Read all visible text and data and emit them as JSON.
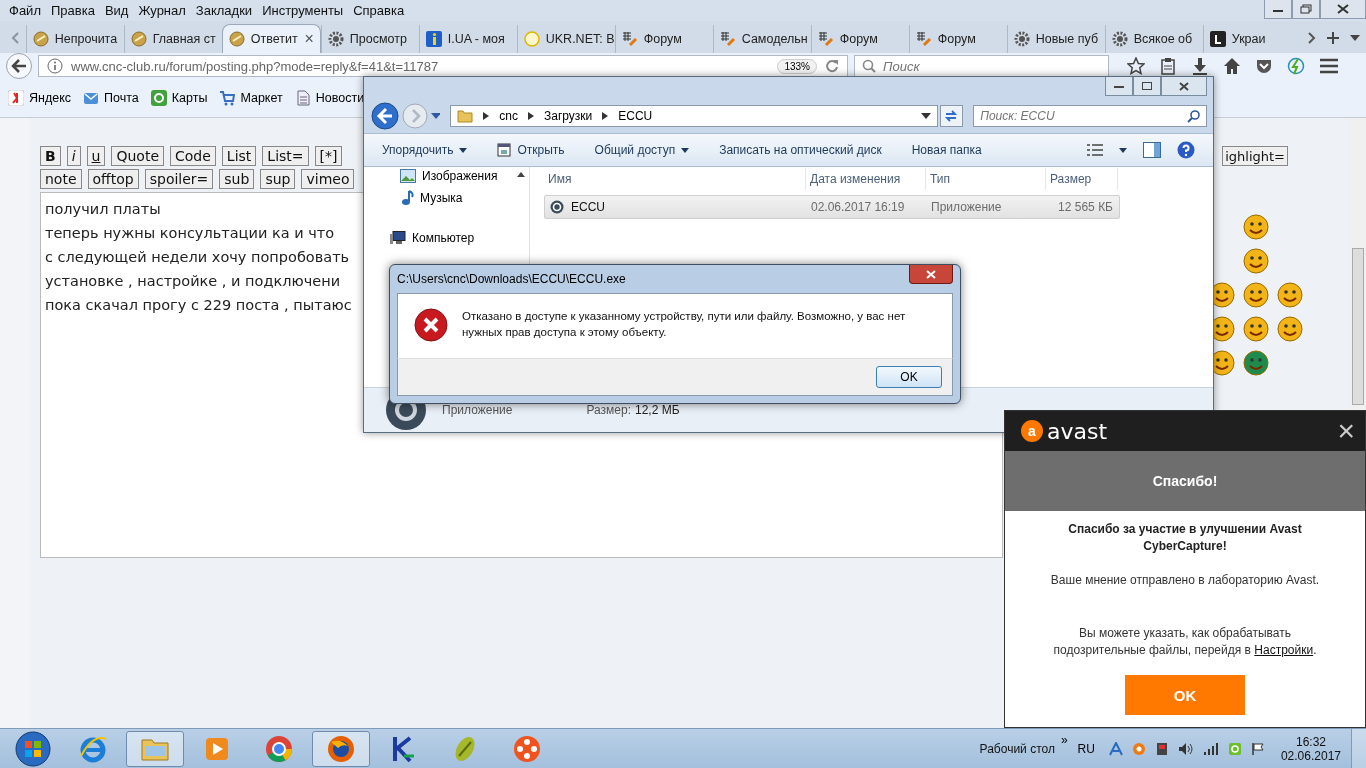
{
  "browser": {
    "menu": [
      "Файл",
      "Правка",
      "Вид",
      "Журнал",
      "Закладки",
      "Инструменты",
      "Справка"
    ],
    "tabs": [
      {
        "label": "Непрочита",
        "selected": false
      },
      {
        "label": "Главная ст",
        "selected": false
      },
      {
        "label": "Ответит",
        "selected": true
      },
      {
        "label": "Просмотр",
        "selected": false
      },
      {
        "label": "I.UA - моя",
        "selected": false
      },
      {
        "label": "UKR.NET: В",
        "selected": false
      },
      {
        "label": "Форум",
        "selected": false
      },
      {
        "label": "Самодельн",
        "selected": false
      },
      {
        "label": "Форум",
        "selected": false
      },
      {
        "label": "Форум",
        "selected": false
      },
      {
        "label": "Новые пуб",
        "selected": false
      },
      {
        "label": "Всякое об",
        "selected": false
      },
      {
        "label": "Украи",
        "selected": false
      }
    ],
    "close_tab": "×",
    "address": {
      "url": "www.cnc-club.ru/forum/posting.php?mode=reply&f=41&t=11787",
      "zoom": "133%"
    },
    "search": {
      "placeholder": "Поиск"
    },
    "bookmarks": [
      "Яндекс",
      "Почта",
      "Карты",
      "Маркет",
      "Новости"
    ]
  },
  "editor": {
    "toolbar_rows": [
      [
        "B",
        "i",
        "u",
        "Quote",
        "Code",
        "List",
        "List=",
        "[*]"
      ],
      [
        "note",
        "offtop",
        "spoiler=",
        "sub",
        "sup",
        "vimeo"
      ]
    ],
    "right_button": "ighlight=",
    "text_lines": [
      "получил платы",
      "теперь нужны консультации ка и что",
      "с следующей недели хочу попробовать",
      "установке , настройке , и подключени",
      "пока скачал прогу с 229 поста , пытаюс"
    ]
  },
  "explorer": {
    "breadcrumb": [
      "cnc",
      "Загрузки",
      "ECCU"
    ],
    "search": {
      "placeholder": "Поиск: ECCU"
    },
    "toolbar": [
      {
        "label": "Упорядочить",
        "dropdown": true
      },
      {
        "label": "Открыть",
        "dropdown": false
      },
      {
        "label": "Общий доступ",
        "dropdown": true
      },
      {
        "label": "Записать на оптический диск",
        "dropdown": false
      },
      {
        "label": "Новая папка",
        "dropdown": false
      }
    ],
    "nav": [
      "Изображения",
      "Музыка",
      "Компьютер"
    ],
    "columns": [
      "Имя",
      "Дата изменения",
      "Тип",
      "Размер"
    ],
    "rows": [
      {
        "name": "ECCU",
        "date": "02.06.2017 16:19",
        "type": "Приложение",
        "size": "12 565 КБ",
        "selected": true
      }
    ],
    "details": {
      "type": "Приложение",
      "size_label": "Размер:",
      "size": "12,2 МБ"
    }
  },
  "dialog": {
    "title": "C:\\Users\\cnc\\Downloads\\ECCU\\ECCU.exe",
    "message": "Отказано в доступе к указанному устройству, пути или файлу. Возможно,  у вас нет нужных прав доступа к этому объекту.",
    "button": "OK"
  },
  "avast": {
    "brand": "avast",
    "logo_letter": "a",
    "close": "×",
    "heading": "Спасибо!",
    "title": "Спасибо за участие в улучшении Avast CyberCapture!",
    "note": "Ваше мнение отправлено в лабораторию Avast.",
    "hint": "Вы можете указать, как обрабатывать подозрительные файлы, перейдя в",
    "link": "Настройки",
    "hint_end": ".",
    "button": "OK"
  },
  "taskbar": {
    "apps": [
      {
        "kind": "ie",
        "active": false
      },
      {
        "kind": "folder",
        "active": true
      },
      {
        "kind": "media",
        "active": false
      },
      {
        "kind": "chrome",
        "active": false
      },
      {
        "kind": "firefox",
        "active": true
      },
      {
        "kind": "k",
        "active": false
      },
      {
        "kind": "s",
        "active": false
      },
      {
        "kind": "reel",
        "active": false
      }
    ],
    "desktop_label": "Рабочий стол",
    "expand": "»",
    "language": "RU",
    "time": "16:32",
    "date": "02.06.2017"
  }
}
